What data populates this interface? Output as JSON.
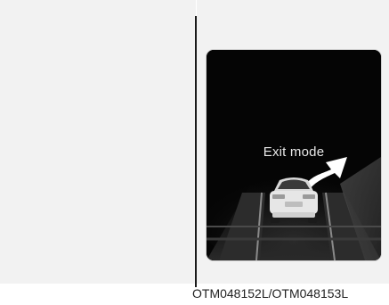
{
  "display": {
    "message": "Exit mode",
    "icon": "vehicle-exit-arrow-icon"
  },
  "caption": "OTM048152L/OTM048153L",
  "colors": {
    "panel_bg": "#f2f2f2",
    "screen_bg": "#050505",
    "text_light": "#e8e8e8",
    "arrow": "#ffffff"
  }
}
